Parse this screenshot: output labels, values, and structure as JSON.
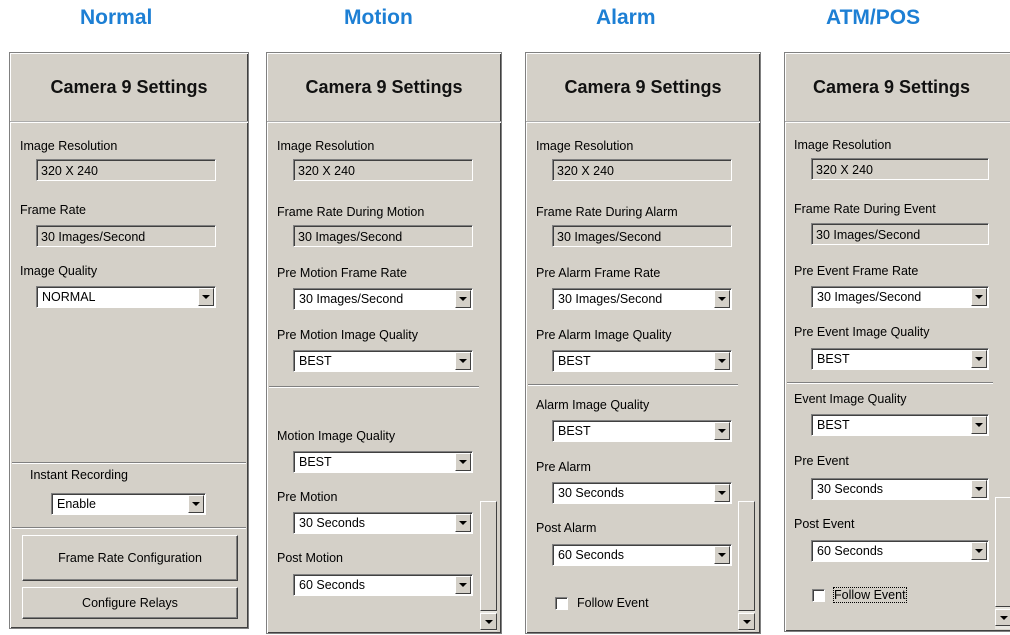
{
  "modes": {
    "normal": "Normal",
    "motion": "Motion",
    "alarm": "Alarm",
    "atm": "ATM/POS"
  },
  "colors": {
    "mode_title": "#1d7fd4",
    "panel_bg": "#d4d0c8"
  },
  "normal": {
    "title": "Camera 9 Settings",
    "res_label": "Image Resolution",
    "res_value": "320 X 240",
    "fr_label": "Frame Rate",
    "fr_value": "30 Images/Second",
    "iq_label": "Image Quality",
    "iq_value": "NORMAL",
    "ir_label": "Instant Recording",
    "ir_value": "Enable",
    "frc_button": "Frame Rate Configuration",
    "relay_button": "Configure Relays"
  },
  "motion": {
    "title": "Camera 9 Settings",
    "res_label": "Image Resolution",
    "res_value": "320 X 240",
    "fr_label": "Frame Rate During Motion",
    "fr_value": "30 Images/Second",
    "pre_fr_label": "Pre Motion Frame Rate",
    "pre_fr_value": "30 Images/Second",
    "pre_iq_label": "Pre Motion Image Quality",
    "pre_iq_value": "BEST",
    "iq_label": "Motion Image Quality",
    "iq_value": "BEST",
    "pre_label": "Pre Motion",
    "pre_value": "30 Seconds",
    "post_label": "Post Motion",
    "post_value": "60 Seconds"
  },
  "alarm": {
    "title": "Camera 9 Settings",
    "res_label": "Image Resolution",
    "res_value": "320 X 240",
    "fr_label": "Frame Rate During Alarm",
    "fr_value": "30 Images/Second",
    "pre_fr_label": "Pre Alarm Frame Rate",
    "pre_fr_value": "30 Images/Second",
    "pre_iq_label": "Pre Alarm Image Quality",
    "pre_iq_value": "BEST",
    "iq_label": "Alarm Image Quality",
    "iq_value": "BEST",
    "pre_label": "Pre Alarm",
    "pre_value": "30 Seconds",
    "post_label": "Post Alarm",
    "post_value": "60 Seconds",
    "follow_label": "Follow Event"
  },
  "atm": {
    "title": "Camera 9 Settings",
    "res_label": "Image Resolution",
    "res_value": "320 X 240",
    "fr_label": "Frame Rate During Event",
    "fr_value": "30 Images/Second",
    "pre_fr_label": "Pre Event Frame Rate",
    "pre_fr_value": "30 Images/Second",
    "pre_iq_label": "Pre Event Image Quality",
    "pre_iq_value": "BEST",
    "iq_label": "Event Image Quality",
    "iq_value": "BEST",
    "pre_label": "Pre Event",
    "pre_value": "30 Seconds",
    "post_label": "Post Event",
    "post_value": "60 Seconds",
    "follow_label": "Follow Event"
  }
}
